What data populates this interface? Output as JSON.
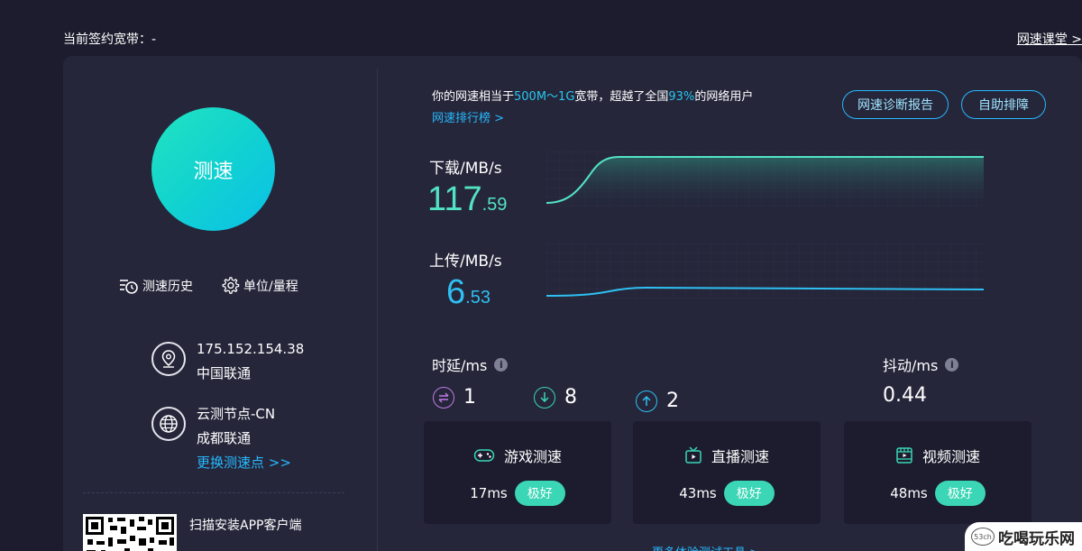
{
  "header": {
    "bandwidth_label": "当前签约宽带：-",
    "course_link": "网速课堂 >"
  },
  "left": {
    "speed_button": "测速",
    "history_label": "测速历史",
    "unit_label": "单位/量程",
    "ip": "175.152.154.38",
    "isp": "中国联通",
    "node_name": "云测节点-CN",
    "node_isp": "成都联通",
    "change_node": "更换测速点 >>",
    "qr_label": "扫描安装APP客户端"
  },
  "summary": {
    "prefix": "你的网速相当于",
    "bandwidth": "500M～1G",
    "middle": "宽带，超越了全国",
    "percent": "93%",
    "suffix": "的网络用户",
    "rank_link": "网速排行榜 >",
    "diagnose_button": "网速诊断报告",
    "troubleshoot_button": "自助排障"
  },
  "download": {
    "label": "下载/MB/s",
    "value_int": "117",
    "value_dec": ".59",
    "value": 117.59
  },
  "upload": {
    "label": "上传/MB/s",
    "value_int": "6",
    "value_dec": ".53",
    "value": 6.53
  },
  "latency": {
    "label": "时延/ms",
    "help": "i",
    "items": [
      {
        "icon": "swap-icon",
        "value": "1"
      },
      {
        "icon": "download-arrow-icon",
        "value": "8"
      },
      {
        "icon": "upload-arrow-icon",
        "value": "2"
      }
    ]
  },
  "jitter": {
    "label": "抖动/ms",
    "help": "i",
    "value": "0.44"
  },
  "cards": [
    {
      "icon": "gamepad-icon",
      "title": "游戏测速",
      "ms": "17ms",
      "badge": "极好"
    },
    {
      "icon": "tv-icon",
      "title": "直播测速",
      "ms": "43ms",
      "badge": "极好"
    },
    {
      "icon": "film-icon",
      "title": "视频测速",
      "ms": "48ms",
      "badge": "极好"
    }
  ],
  "more_link": "更多体验测试工具 >",
  "watermark": {
    "logo": "53ch",
    "text": "吃喝玩乐网"
  },
  "colors": {
    "accent_teal": "#3ad6b5",
    "accent_blue": "#27b8ff",
    "download_value": "#52e3c2",
    "upload_value": "#2ec0f2",
    "background": "#1c1c2e",
    "panel": "#25263a"
  }
}
